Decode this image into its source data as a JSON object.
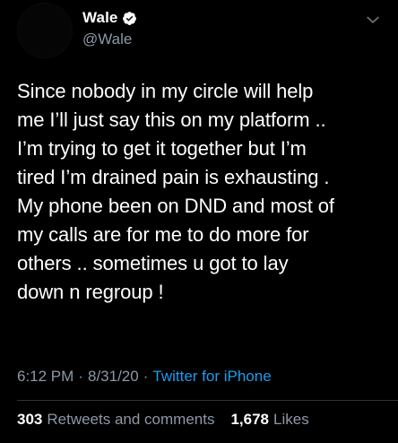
{
  "author": {
    "display_name": "Wale",
    "handle": "@Wale",
    "verified": true
  },
  "tweet": {
    "text": "Since nobody in my circle will help\nme I’ll just say this on my platform ..\nI’m trying to get it together but I’m\ntired I’m drained pain is exhausting .\nMy phone been on DND and most of\nmy calls are for me to do more for\nothers .. sometimes u got to lay\ndown n regroup !",
    "time": "6:12 PM",
    "date": "8/31/20",
    "separator": "·",
    "source": "Twitter for iPhone"
  },
  "stats": {
    "retweets_count": "303",
    "retweets_label": "Retweets and comments",
    "likes_count": "1,678",
    "likes_label": "Likes"
  },
  "icons": {
    "verified": "verified-badge-icon",
    "more": "chevron-down-icon"
  },
  "colors": {
    "background": "#000000",
    "text": "#ffffff",
    "secondary": "#8b98a5",
    "link": "#1d9bf0",
    "divider": "#2f3336"
  }
}
